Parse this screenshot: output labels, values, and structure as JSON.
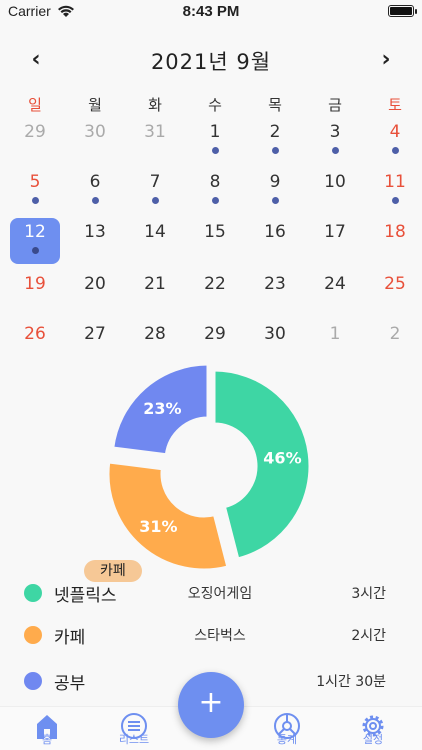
{
  "status_bar": {
    "carrier": "Carrier",
    "time": "8:43 PM"
  },
  "calendar": {
    "title": "2021년 9월",
    "prev_icon": "‹",
    "next_icon": "›",
    "weekdays": [
      "일",
      "월",
      "화",
      "수",
      "목",
      "금",
      "토"
    ],
    "weeks": [
      [
        {
          "d": "29",
          "o": true
        },
        {
          "d": "30",
          "o": true
        },
        {
          "d": "31",
          "o": true
        },
        {
          "d": "1",
          "dot": true
        },
        {
          "d": "2",
          "dot": true
        },
        {
          "d": "3",
          "dot": true
        },
        {
          "d": "4",
          "dot": true
        }
      ],
      [
        {
          "d": "5",
          "dot": true
        },
        {
          "d": "6",
          "dot": true
        },
        {
          "d": "7",
          "dot": true
        },
        {
          "d": "8",
          "dot": true
        },
        {
          "d": "9",
          "dot": true
        },
        {
          "d": "10"
        },
        {
          "d": "11",
          "dot": true
        }
      ],
      [
        {
          "d": "12",
          "dot": true,
          "selected": true
        },
        {
          "d": "13"
        },
        {
          "d": "14"
        },
        {
          "d": "15"
        },
        {
          "d": "16"
        },
        {
          "d": "17"
        },
        {
          "d": "18"
        }
      ],
      [
        {
          "d": "19"
        },
        {
          "d": "20"
        },
        {
          "d": "21"
        },
        {
          "d": "22"
        },
        {
          "d": "23"
        },
        {
          "d": "24"
        },
        {
          "d": "25"
        }
      ],
      [
        {
          "d": "26"
        },
        {
          "d": "27"
        },
        {
          "d": "28"
        },
        {
          "d": "29"
        },
        {
          "d": "30"
        },
        {
          "d": "1",
          "o": true
        },
        {
          "d": "2",
          "o": true
        }
      ]
    ]
  },
  "chart_data": {
    "type": "pie",
    "donut": true,
    "slices": [
      {
        "label": "넷플릭스",
        "value": 46,
        "display": "46%",
        "color": "#3ed6a4"
      },
      {
        "label": "카페",
        "value": 31,
        "display": "31%",
        "color": "#ffab4c"
      },
      {
        "label": "공부",
        "value": 23,
        "display": "23%",
        "color": "#7088f0"
      }
    ],
    "highlight_tag": "카페"
  },
  "legend": [
    {
      "name": "넷플릭스",
      "detail": "오징어게임",
      "time": "3시간",
      "color": "#3ed6a4"
    },
    {
      "name": "카페",
      "detail": "스타벅스",
      "time": "2시간",
      "color": "#ffab4c"
    },
    {
      "name": "공부",
      "detail": "",
      "time": "1시간 30분",
      "color": "#7088f0"
    }
  ],
  "fab": {
    "label": "+"
  },
  "tabs": [
    {
      "label": "홈",
      "icon": "home-icon"
    },
    {
      "label": "리스트",
      "icon": "list-icon"
    },
    {
      "label": "통계",
      "icon": "stats-icon"
    },
    {
      "label": "설정",
      "icon": "gear-icon"
    }
  ],
  "colors": {
    "accent": "#6e8ff0",
    "weekend": "#e8503a",
    "dot": "#4e5fa8"
  }
}
